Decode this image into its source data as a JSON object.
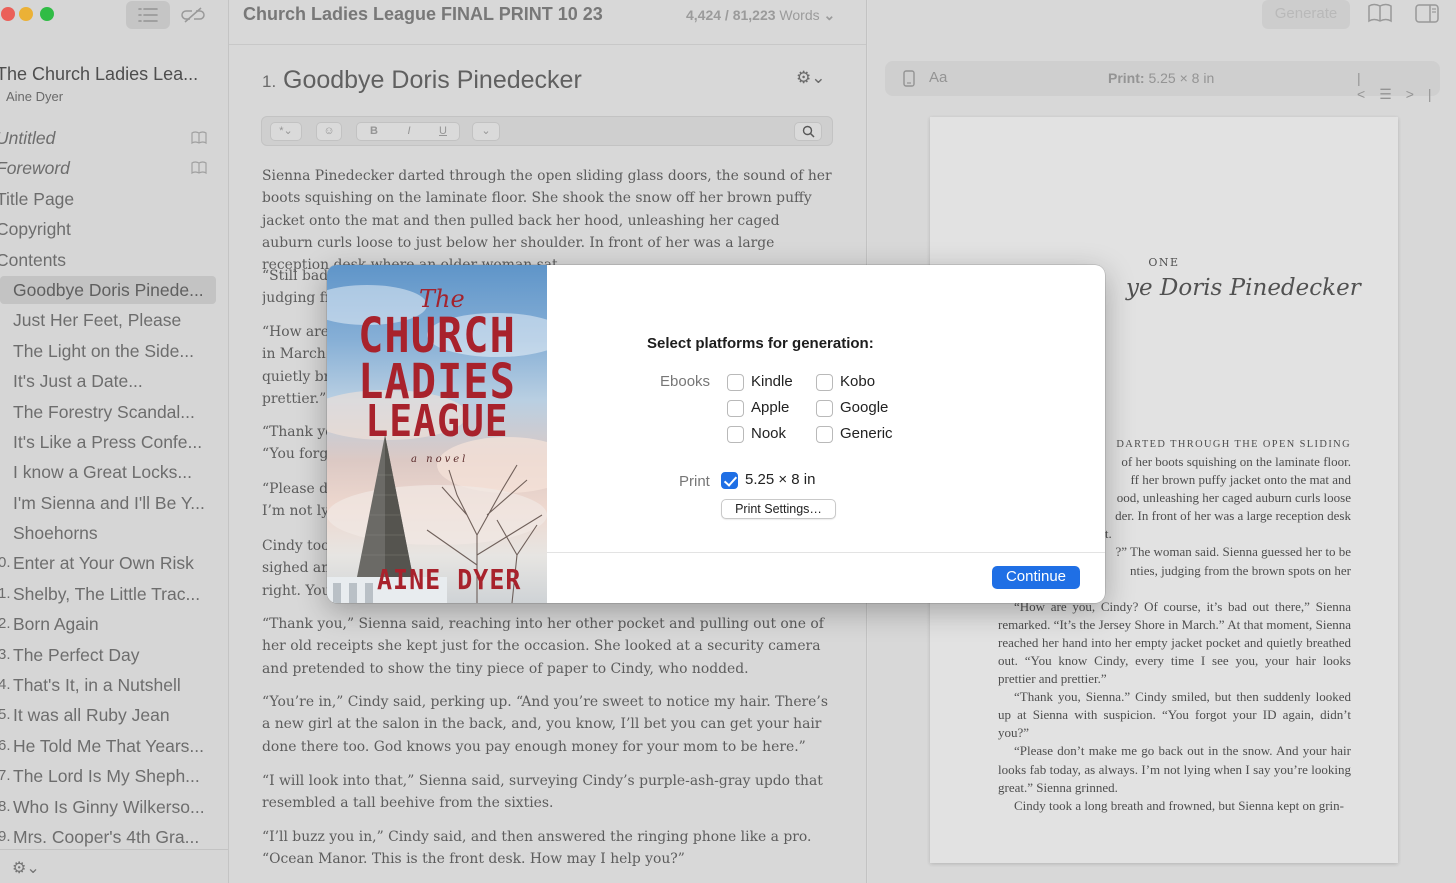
{
  "app": {
    "document_title": "Church Ladies League FINAL PRINT 10 23",
    "word_count": "4,424 / 81,223",
    "word_count_unit": "Words",
    "generate_label": "Generate"
  },
  "sidebar": {
    "book_title": "The Church Ladies Lea...",
    "author": "Aine Dyer",
    "front_matter": [
      {
        "label": "Untitled",
        "italic": true,
        "icon": "book-icon"
      },
      {
        "label": "Foreword",
        "italic": true,
        "icon": "book-icon"
      },
      {
        "label": "Title Page"
      },
      {
        "label": "Copyright"
      },
      {
        "label": "Contents"
      }
    ],
    "chapters": [
      {
        "label": "Goodbye Doris Pinede...",
        "active": true
      },
      {
        "label": "Just Her Feet, Please"
      },
      {
        "label": "The Light on the Side..."
      },
      {
        "label": "It's Just a Date..."
      },
      {
        "label": "The Forestry Scandal..."
      },
      {
        "label": "It's Like a Press Confe..."
      },
      {
        "label": "I know a Great Locks..."
      },
      {
        "label": "I'm Sienna and I'll Be Y..."
      },
      {
        "label": "Shoehorns"
      },
      {
        "num": "0.",
        "label": "Enter at Your Own Risk"
      },
      {
        "num": "1.",
        "label": "Shelby, The Little Trac..."
      },
      {
        "num": "2.",
        "label": "Born Again"
      },
      {
        "num": "3.",
        "label": "The Perfect Day"
      },
      {
        "num": "4.",
        "label": "That's It, in a Nutshell"
      },
      {
        "num": "5.",
        "label": "It was all Ruby Jean"
      },
      {
        "num": "6.",
        "label": "He Told Me That Years..."
      },
      {
        "num": "7.",
        "label": "The Lord Is My Sheph..."
      },
      {
        "num": "8.",
        "label": "Who Is Ginny Wilkerso..."
      },
      {
        "num": "9.",
        "label": "Mrs. Cooper's 4th Gra..."
      }
    ]
  },
  "editor": {
    "chapter_number": "1.",
    "chapter_title": "Goodbye Doris Pinedecker",
    "toolbar": {
      "format": "*",
      "bold": "B",
      "italic": "I",
      "underline": "U"
    },
    "paragraphs": {
      "p1": "Sienna Pinedecker darted through the open sliding glass doors, the sound of her boots squishing on the laminate floor. She shook the snow off her brown puffy jacket onto the mat and then pulled back her hood, unleashing her caged auburn curls loose to just below her shoulder. In front of her was a large reception desk where an older woman sat.",
      "p2a": "“Still bad c",
      "p2b": "judging fro",
      "p3a": "“How are y",
      "p3b": "in March.”",
      "p3c": "quietly bre",
      "p3d": "prettier.”",
      "p4a": "“Thank yo",
      "p4b": "“You forgo",
      "p4c": "“Please do",
      "p4d": "I’m not lyi",
      "p4e": "Cindy took",
      "p4f": "sighed and",
      "p4g": "right. You",
      "p5": "“Thank you,” Sienna said, reaching into her other pocket and pulling out one of her old receipts she kept just for the occasion. She looked at a security camera and pretended to show the tiny piece of paper to Cindy, who nodded.",
      "p6": "“You’re in,” Cindy said, perking up. “And you’re sweet to notice my hair. There’s a new girl at the salon in the back, and, you know, I’ll bet you can get your hair done there too. God knows you pay enough money for your mom to be here.”",
      "p7": "“I will look into that,” Sienna said, surveying Cindy’s purple-ash-gray updo that resembled a tall beehive from the sixties.",
      "p8": "“I’ll buzz you in,” Cindy said, and then answered the ringing phone like a pro. “Ocean Manor. This is the front desk. How may I help you?”"
    }
  },
  "preview": {
    "font_label": "Aa",
    "size_prefix": "Print:",
    "size_value": "5.25 × 8 in",
    "page": {
      "chapter_kicker": "ONE",
      "chapter_title": "ye Doris Pinedecker",
      "smallcaps_line": "darted through the open sliding",
      "lines": [
        "of her boots squishing on the laminate floor.",
        "ff her brown puffy jacket onto the mat and",
        "ood, unleashing her caged auburn curls loose",
        "der. In front of her was a large reception desk",
        "sat.",
        "?” The woman said. Sienna guessed her to be",
        "nties, judging from the brown spots on her"
      ],
      "paragraphs": [
        "“How are you, Cindy? Of course, it’s bad out there,” Sienna remarked. “It’s the Jersey Shore in March.” At that moment, Sienna reached her hand into her empty jacket pocket and quietly breathed out. “You know Cindy, every time I see you, your hair looks prettier and prettier.”",
        "“Thank you, Sienna.” Cindy smiled, but then suddenly looked up at Sienna with suspicion. “You forgot your ID again, didn’t you?”",
        "“Please don’t make me go back out in the snow. And your hair looks fab today, as always. I’m not lying when I say you’re looking great.” Sienna grinned.",
        "Cindy took a long breath and frowned, but Sienna kept on grin-"
      ]
    }
  },
  "modal": {
    "heading": "Select platforms for generation:",
    "ebooks_label": "Ebooks",
    "print_label": "Print",
    "ebook_platforms": [
      {
        "label": "Kindle",
        "checked": false
      },
      {
        "label": "Apple",
        "checked": false
      },
      {
        "label": "Nook",
        "checked": false
      },
      {
        "label": "Kobo",
        "checked": false
      },
      {
        "label": "Google",
        "checked": false
      },
      {
        "label": "Generic",
        "checked": false
      }
    ],
    "print_option": {
      "label": "5.25 × 8 in",
      "checked": true
    },
    "print_settings_label": "Print Settings…",
    "continue_label": "Continue",
    "cover": {
      "the": "The",
      "title_lines": [
        "CHURCH",
        "LADIES",
        "LEAGUE"
      ],
      "subtitle": "a novel",
      "author": "AINE DYER"
    }
  },
  "colors": {
    "accent": "#1f6fe5",
    "cover_red": "#a8222c",
    "traffic_close": "#fe5f57",
    "traffic_min": "#febc2e",
    "traffic_max": "#28c840"
  }
}
